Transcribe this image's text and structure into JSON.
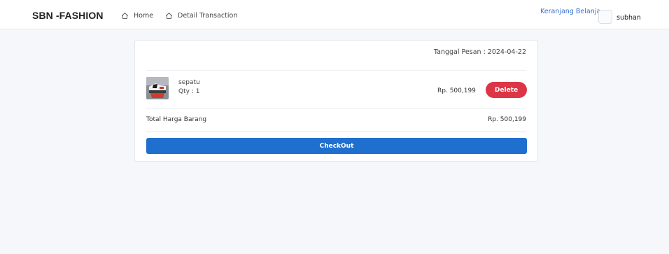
{
  "navbar": {
    "brand": "SBN -FASHION",
    "links": [
      {
        "label": "Home",
        "icon": "home-icon"
      },
      {
        "label": "Detail Transaction",
        "icon": "home-icon"
      }
    ],
    "cart_label": "Keranjang Belanja",
    "user_name": "subhan"
  },
  "order": {
    "date_text": "Tanggal Pesan : 2024-04-22",
    "items": [
      {
        "name": "sepatu",
        "qty": "Qty : 1",
        "price": "Rp. 500,199",
        "delete_label": "Delete",
        "thumb_icon": "shoe-thumbnail"
      }
    ],
    "total_label": "Total Harga Barang",
    "total_value": "Rp. 500,199",
    "checkout_label": "CheckOut"
  },
  "colors": {
    "primary": "#1f6fce",
    "danger": "#dc3545",
    "link": "#3b6fd0",
    "background": "#f5f7fb"
  }
}
